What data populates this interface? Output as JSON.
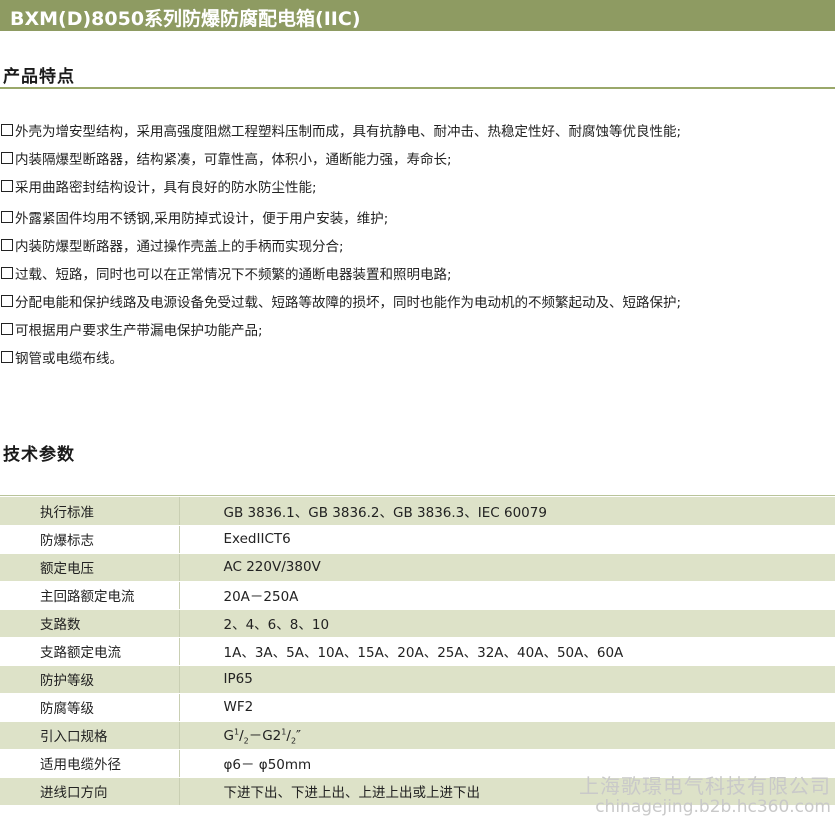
{
  "header": {
    "title": "BXM(D)8050系列防爆防腐配电箱(IIC)"
  },
  "features_section": {
    "title": "产品特点",
    "items": [
      "外壳为增安型结构，采用高强度阻燃工程塑料压制而成，具有抗静电、耐冲击、热稳定性好、耐腐蚀等优良性能;",
      "内装隔爆型断路器，结构紧凑，可靠性高，体积小，通断能力强，寿命长;",
      "采用曲路密封结构设计，具有良好的防水防尘性能;",
      "外露紧固件均用不锈钢,采用防掉式设计，便于用户安装，维护;",
      "内装防爆型断路器，通过操作壳盖上的手柄而实现分合;",
      "过载、短路，同时也可以在正常情况下不频繁的通断电器装置和照明电路;",
      "分配电能和保护线路及电源设备免受过载、短路等故障的损坏，同时也能作为电动机的不频繁起动及、短路保护;",
      "可根据用户要求生产带漏电保护功能产品;",
      "钢管或电缆布线。"
    ]
  },
  "specs_section": {
    "title": "技术参数",
    "rows": [
      {
        "key": "执行标准",
        "value": "GB 3836.1、GB 3836.2、GB 3836.3、IEC 60079"
      },
      {
        "key": "防爆标志",
        "value": "ExedIICT6"
      },
      {
        "key": "额定电压",
        "value": "AC 220V/380V"
      },
      {
        "key": "主回路额定电流",
        "value": "20A－250A"
      },
      {
        "key": "支路数",
        "value": "2、4、6、8、10"
      },
      {
        "key": "支路额定电流",
        "value": "1A、3A、5A、10A、15A、20A、25A、32A、40A、50A、60A"
      },
      {
        "key": "防护等级",
        "value": "IP65"
      },
      {
        "key": "防腐等级",
        "value": "WF2"
      },
      {
        "key": "引入口规格",
        "value": ""
      },
      {
        "key": "适用电缆外径",
        "value": "φ6－ φ50mm"
      },
      {
        "key": "进线口方向",
        "value": "下进下出、下进上出、上进上出或上进下出"
      }
    ],
    "thread_spec": {
      "a": "G",
      "a_num": "1",
      "a_den": "2",
      "sep": "－G2",
      "b_num": "1",
      "b_den": "2",
      "tail": "″"
    }
  },
  "watermark": {
    "company": "上海歌璟电气科技有限公司",
    "url": "chinagejing.b2b.hc360.com"
  },
  "colors": {
    "title_bar": "#8e9b62",
    "row_shade": "#dde2c8",
    "rule": "#9aa86a"
  }
}
